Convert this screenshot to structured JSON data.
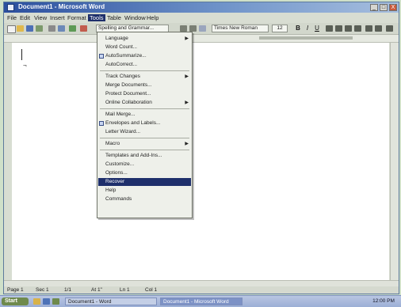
{
  "window": {
    "title": "Document1 - Microsoft Word",
    "buttons": [
      "_",
      "□",
      "X"
    ]
  },
  "menubar": {
    "items": [
      "File",
      "Edit",
      "View",
      "Insert",
      "Format",
      "Tools",
      "Table",
      "Window",
      "Help"
    ]
  },
  "toolbar": {
    "style_value": "Spelling and Grammar...",
    "font_value": "Times New Roman",
    "font_size": "12",
    "bold": "B",
    "italic": "I",
    "underline": "U"
  },
  "tools_menu": {
    "items": [
      {
        "label": "Language",
        "has_submenu": true,
        "icon": "none"
      },
      {
        "label": "Word Count...",
        "has_submenu": false,
        "icon": "none"
      },
      {
        "label": "AutoSummarize...",
        "has_submenu": false,
        "icon": "summary-icon"
      },
      {
        "label": "AutoCorrect...",
        "has_submenu": false,
        "icon": "none"
      },
      {
        "label": "Track Changes",
        "has_submenu": true,
        "icon": "none"
      },
      {
        "label": "Merge Documents...",
        "has_submenu": false,
        "icon": "none"
      },
      {
        "label": "Protect Document...",
        "has_submenu": false,
        "icon": "none"
      },
      {
        "label": "Online Collaboration",
        "has_submenu": true,
        "icon": "none"
      },
      {
        "label": "Mail Merge...",
        "has_submenu": false,
        "icon": "none"
      },
      {
        "label": "Envelopes and Labels...",
        "has_submenu": false,
        "icon": "envelope-icon"
      },
      {
        "label": "Letter Wizard...",
        "has_submenu": false,
        "icon": "none"
      },
      {
        "label": "Macro",
        "has_submenu": true,
        "icon": "none"
      },
      {
        "label": "Templates and Add-Ins...",
        "has_submenu": false,
        "icon": "none"
      },
      {
        "label": "Customize...",
        "has_submenu": false,
        "icon": "none"
      },
      {
        "label": "Options...",
        "has_submenu": false,
        "icon": "none"
      },
      {
        "label": "Recover",
        "has_submenu": false,
        "icon": "none"
      },
      {
        "label": "Help",
        "has_submenu": false,
        "icon": "none"
      },
      {
        "label": "Commands",
        "has_submenu": false,
        "icon": "none"
      }
    ],
    "selected_label": "Recover"
  },
  "statusbar": {
    "page": "Page 1",
    "section": "Sec 1",
    "position": "1/1",
    "at": "At 1\"",
    "ln": "Ln 1",
    "col": "Col 1"
  },
  "taskbar": {
    "start_label": "Start",
    "tasks": [
      "Document1 - Word",
      "Document1 - Microsoft Word"
    ],
    "clock": "12:00 PM"
  },
  "colors": {
    "title_bar": "#2b4f9e",
    "menu_highlight": "#1e2f6b",
    "page": "#ffffff",
    "desktop": "#cfe0c9"
  }
}
